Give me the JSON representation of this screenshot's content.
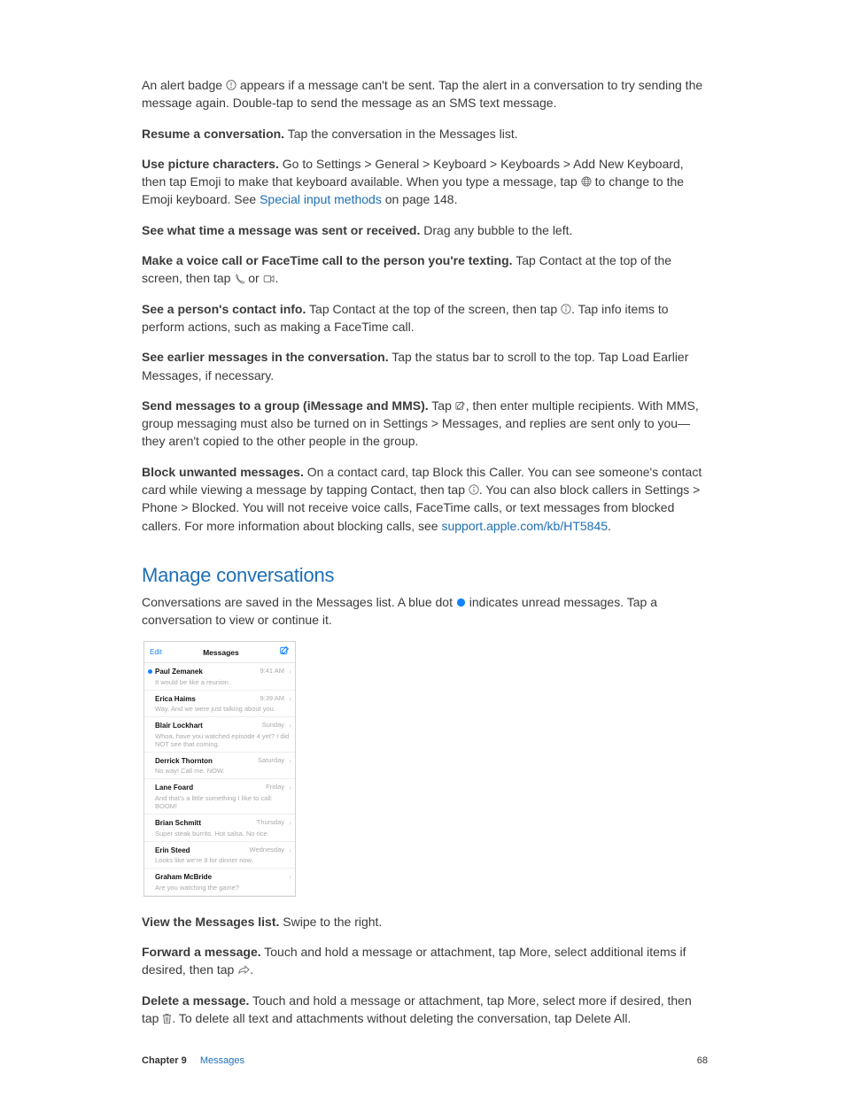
{
  "para_alert": {
    "t1": "An alert badge ",
    "t2": " appears if a message can't be sent. Tap the alert in a conversation to try sending the message again. Double-tap to send the message as an SMS text message."
  },
  "para_resume": {
    "b": "Resume a conversation.",
    "t": " Tap the conversation in the Messages list."
  },
  "para_picture": {
    "b": "Use picture characters.",
    "t1": " Go to Settings > General > Keyboard > Keyboards > Add New Keyboard, then tap Emoji to make that keyboard available. When you type a message, tap ",
    "t2": " to change to the Emoji keyboard. See ",
    "link": "Special input methods",
    "t3": " on page 148."
  },
  "para_seetime": {
    "b": "See what time a message was sent or received.",
    "t": " Drag any bubble to the left."
  },
  "para_voice": {
    "b": "Make a voice call or FaceTime call to the person you're texting.",
    "t1": " Tap Contact at the top of the screen, then tap ",
    "t2": " or ",
    "t3": "."
  },
  "para_contactinfo": {
    "b": "See a person's contact info.",
    "t1": " Tap Contact at the top of the screen, then tap ",
    "t2": ". Tap info items to perform actions, such as making a FaceTime call."
  },
  "para_earlier": {
    "b": "See earlier messages in the conversation.",
    "t": " Tap the status bar to scroll to the top. Tap Load Earlier Messages, if necessary."
  },
  "para_group": {
    "b": "Send messages to a group (iMessage and MMS).",
    "t1": " Tap ",
    "t2": ", then enter multiple recipients. With MMS, group messaging must also be turned on in Settings > Messages, and replies are sent only to you—they aren't copied to the other people in the group."
  },
  "para_block": {
    "b": "Block unwanted messages.",
    "t1": " On a contact card, tap Block this Caller. You can see someone's contact card while viewing a message by tapping Contact, then tap ",
    "t2": ". You can also block callers in Settings > Phone > Blocked. You will not receive voice calls, FaceTime calls, or text messages from blocked callers. For more information about blocking calls, see ",
    "link": "support.apple.com/kb/HT5845",
    "t3": "."
  },
  "heading_manage": "Manage conversations",
  "para_manage": {
    "t1": "Conversations are saved in the Messages list. A blue dot ",
    "t2": " indicates unread messages. Tap a conversation to view or continue it."
  },
  "phone": {
    "edit": "Edit",
    "title": "Messages",
    "rows": [
      {
        "name": "Paul Zemanek",
        "time": "9:41 AM",
        "preview": "It would be like a reunion.",
        "unread": true
      },
      {
        "name": "Erica Haims",
        "time": "9:39 AM",
        "preview": "Way. And we were just talking about you.",
        "unread": false
      },
      {
        "name": "Blair Lockhart",
        "time": "Sunday",
        "preview": "Whoa, have you watched episode 4 yet? I did NOT see that coming.",
        "unread": false
      },
      {
        "name": "Derrick Thornton",
        "time": "Saturday",
        "preview": "No way! Call me. NOW.",
        "unread": false
      },
      {
        "name": "Lane Foard",
        "time": "Friday",
        "preview": "And that's a little something I like to call: BOOM!",
        "unread": false
      },
      {
        "name": "Brian Schmitt",
        "time": "Thursday",
        "preview": "Super steak burrito. Hot salsa. No rice.",
        "unread": false
      },
      {
        "name": "Erin Steed",
        "time": "Wednesday",
        "preview": "Looks like we're 8 for dinner now.",
        "unread": false
      },
      {
        "name": "Graham McBride",
        "time": "",
        "preview": "Are you watching the game?",
        "unread": false
      }
    ]
  },
  "para_viewlist": {
    "b": "View the Messages list.",
    "t": " Swipe to the right."
  },
  "para_forward": {
    "b": "Forward a message.",
    "t1": " Touch and hold a message or attachment, tap More, select additional items if desired, then tap ",
    "t2": "."
  },
  "para_delete": {
    "b": "Delete a message.",
    "t1": " Touch and hold a message or attachment, tap More, select more if desired, then tap ",
    "t2": ". To delete all text and attachments without deleting the conversation, tap Delete All."
  },
  "footer": {
    "chapter": "Chapter  9",
    "section": "Messages",
    "page": "68"
  }
}
